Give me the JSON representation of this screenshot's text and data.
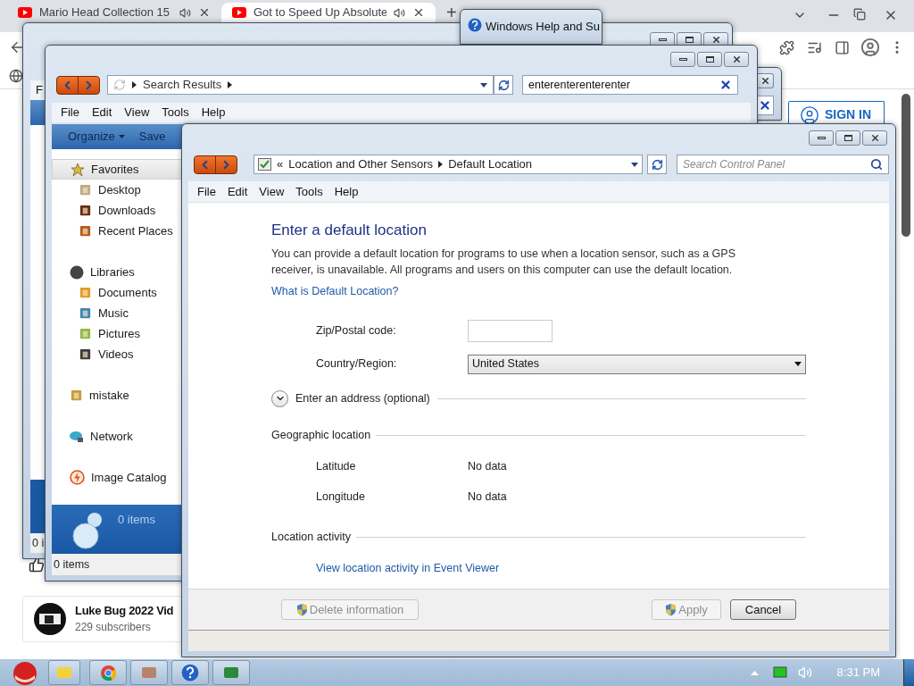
{
  "browser": {
    "tabs": [
      {
        "title": "Mario Head Collection 15",
        "selected": false
      },
      {
        "title": "Got to Speed Up Absolute",
        "selected": true
      }
    ],
    "new_tab": "+",
    "sign_in": "SIGN IN",
    "channel": {
      "name": "Luke Bug 2022 Vid",
      "subscribers": "229 subscribers"
    }
  },
  "help_window": {
    "title": "Windows Help and Su"
  },
  "back_window": {
    "menu_fragment": "F",
    "status_fragment": "0 i"
  },
  "search_window": {
    "address": "Search Results",
    "search_value": "enterenterenterenter",
    "menu": [
      "File",
      "Edit",
      "View",
      "Tools",
      "Help"
    ],
    "commands": [
      {
        "label": "Organize",
        "dropdown": true
      },
      {
        "label": "Save",
        "dropdown": false
      }
    ],
    "nav": [
      {
        "label": "Favorites",
        "kind": "star",
        "selected": true,
        "children": [
          {
            "label": "Desktop",
            "kind": "desktop",
            "selected": false
          },
          {
            "label": "Downloads",
            "kind": "downloads",
            "selected": false
          },
          {
            "label": "Recent Places",
            "kind": "recent",
            "selected": false
          }
        ]
      },
      {
        "label": "Libraries",
        "kind": "library",
        "selected": false,
        "children": [
          {
            "label": "Documents",
            "kind": "documents",
            "selected": false
          },
          {
            "label": "Music",
            "kind": "music",
            "selected": false
          },
          {
            "label": "Pictures",
            "kind": "pictures",
            "selected": false
          },
          {
            "label": "Videos",
            "kind": "videos",
            "selected": false
          }
        ]
      },
      {
        "label": "mistake",
        "kind": "homegroup",
        "selected": false
      },
      {
        "label": "Network",
        "kind": "network",
        "selected": false
      },
      {
        "label": "Image Catalog",
        "kind": "catalog",
        "selected": false
      }
    ],
    "details": "0 items",
    "status": "0 items"
  },
  "control_panel": {
    "breadcrumb_overflow": "«",
    "breadcrumb": [
      "Location and Other Sensors",
      "Default Location"
    ],
    "search_placeholder": "Search Control Panel",
    "menu": [
      "File",
      "Edit",
      "View",
      "Tools",
      "Help"
    ],
    "heading": "Enter a default location",
    "description": "You can provide a default location for programs to use when a location sensor, such as a GPS receiver, is unavailable. All programs and users on this computer can use the default location.",
    "help_link": "What is Default Location?",
    "zip_label": "Zip/Postal code:",
    "country_label": "Country/Region:",
    "country_value": "United States",
    "address_toggle": {
      "label": "Enter an address (optional)",
      "expanded": false
    },
    "geo_title": "Geographic location",
    "geo_rows": [
      {
        "label": "Latitude",
        "value": "No data"
      },
      {
        "label": "Longitude",
        "value": "No data"
      }
    ],
    "activity_title": "Location activity",
    "activity_link": "View location activity in Event Viewer",
    "buttons": [
      {
        "label": "Delete information",
        "shield": true,
        "disabled": true
      },
      {
        "label": "Apply",
        "shield": true,
        "disabled": true
      },
      {
        "label": "Cancel",
        "shield": false,
        "disabled": false
      }
    ]
  },
  "taskbar": {
    "clock": "8:31 PM"
  }
}
